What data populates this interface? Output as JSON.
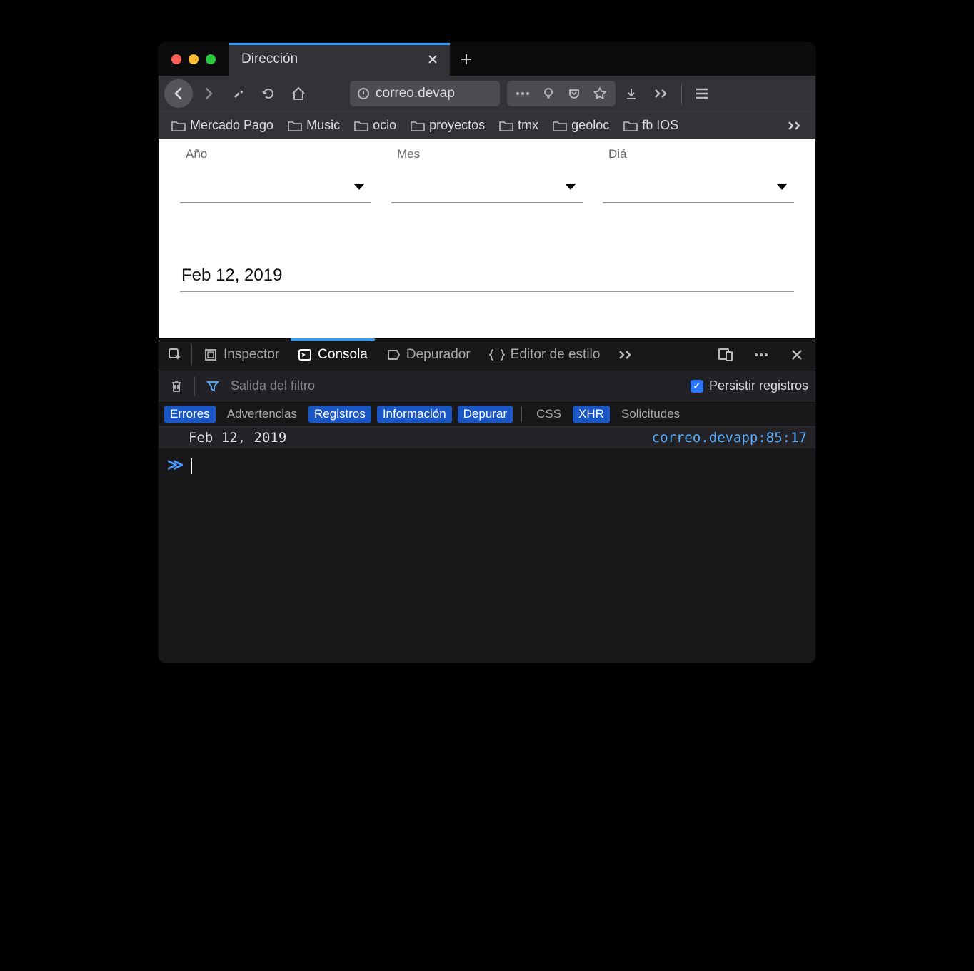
{
  "tab": {
    "title": "Dirección"
  },
  "url": "correo.devap",
  "bookmarks": [
    "Mercado Pago",
    "Music",
    "ocio",
    "proyectos",
    "tmx",
    "geoloc",
    "fb IOS"
  ],
  "page": {
    "year_label": "Año",
    "month_label": "Mes",
    "day_label": "Diá",
    "date_value": "Feb 12, 2019"
  },
  "devtools": {
    "tabs": {
      "inspector": "Inspector",
      "console": "Consola",
      "debugger": "Depurador",
      "style": "Editor de estilo"
    },
    "filter_placeholder": "Salida del filtro",
    "persist_label": "Persistir registros",
    "categories": {
      "errors": "Errores",
      "warnings": "Advertencias",
      "logs": "Registros",
      "info": "Información",
      "debug": "Depurar",
      "css": "CSS",
      "xhr": "XHR",
      "requests": "Solicitudes"
    },
    "log": {
      "message": "Feb 12, 2019",
      "source": "correo.devapp:85:17"
    }
  }
}
